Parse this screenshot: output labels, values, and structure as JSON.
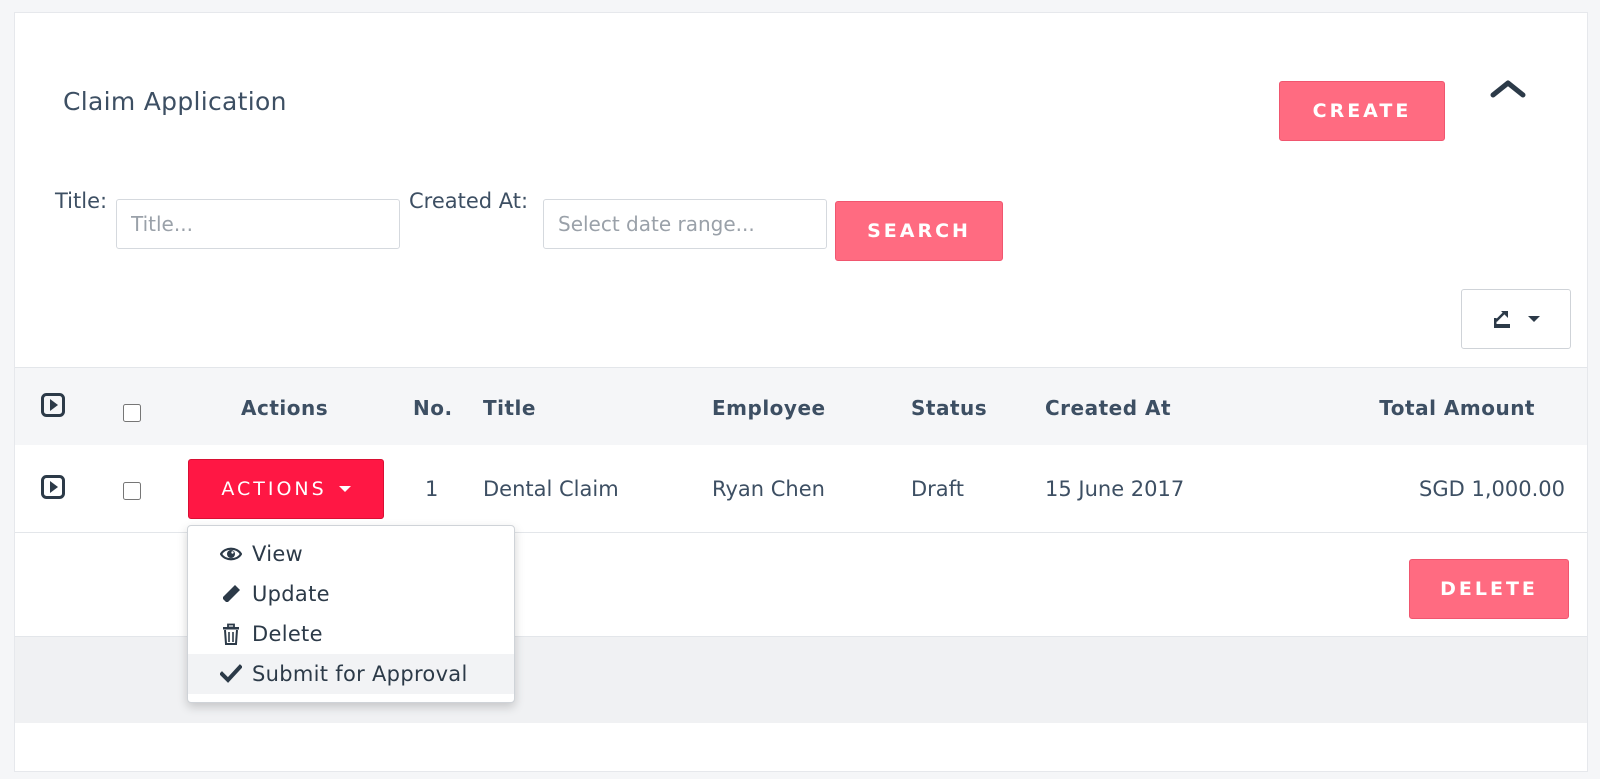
{
  "header": {
    "title": "Claim Application",
    "create_label": "CREATE"
  },
  "filters": {
    "title_label": "Title:",
    "title_placeholder": "Title...",
    "created_label": "Created At:",
    "created_placeholder": "Select date range...",
    "search_label": "SEARCH"
  },
  "table": {
    "columns": {
      "actions": "Actions",
      "no": "No.",
      "title": "Title",
      "employee": "Employee",
      "status": "Status",
      "created": "Created At",
      "amount": "Total Amount"
    },
    "rows": [
      {
        "actions_label": "ACTIONS",
        "no": "1",
        "title": "Dental Claim",
        "employee": "Ryan Chen",
        "status": "Draft",
        "created": "15 June 2017",
        "amount": "SGD 1,000.00"
      }
    ]
  },
  "actions_menu": {
    "items": [
      {
        "label": "View",
        "icon": "eye-icon"
      },
      {
        "label": "Update",
        "icon": "pencil-icon"
      },
      {
        "label": "Delete",
        "icon": "trash-icon"
      },
      {
        "label": "Submit for Approval",
        "icon": "check-icon"
      }
    ]
  },
  "footer": {
    "delete_label": "DELETE"
  },
  "colors": {
    "accent_pink": "#ff6b81",
    "actions_red": "#ff1744",
    "text": "#3d4f63"
  }
}
